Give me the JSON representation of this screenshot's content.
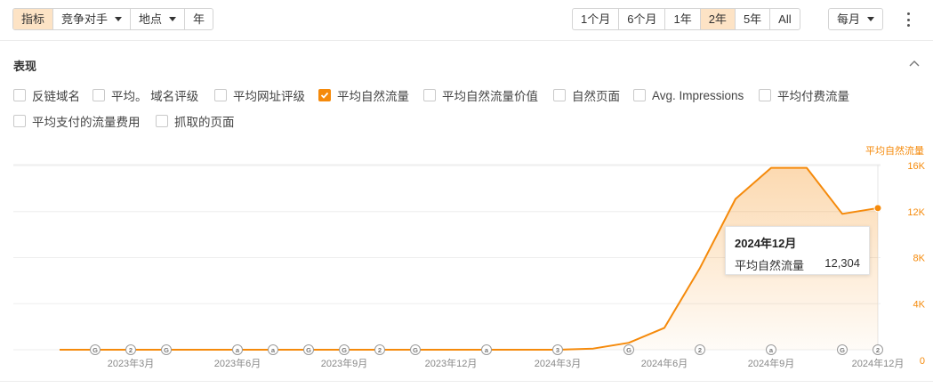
{
  "toolbar": {
    "left_buttons": [
      {
        "label": "指标",
        "active": true,
        "dropdown": false
      },
      {
        "label": "竞争对手",
        "active": false,
        "dropdown": true
      },
      {
        "label": "地点",
        "active": false,
        "dropdown": true
      },
      {
        "label": "年",
        "active": false,
        "dropdown": false
      }
    ],
    "ranges": [
      {
        "label": "1个月",
        "active": false
      },
      {
        "label": "6个月",
        "active": false
      },
      {
        "label": "1年",
        "active": false
      },
      {
        "label": "2年",
        "active": true
      },
      {
        "label": "5年",
        "active": false
      },
      {
        "label": "All",
        "active": false
      }
    ],
    "interval": {
      "label": "每月"
    },
    "menu_icon": "more-vertical-icon"
  },
  "section": {
    "title": "表现",
    "collapse_icon": "chevron-up-icon"
  },
  "metrics": [
    {
      "label": "反链域名",
      "checked": false
    },
    {
      "label": "平均。 域名评级",
      "checked": false
    },
    {
      "label": "平均网址评级",
      "checked": false
    },
    {
      "label": "平均自然流量",
      "checked": true
    },
    {
      "label": "平均自然流量价值",
      "checked": false
    },
    {
      "label": "自然页面",
      "checked": false
    },
    {
      "label": "Avg. Impressions",
      "checked": false
    },
    {
      "label": "平均付费流量",
      "checked": false
    },
    {
      "label": "平均支付的流量费用",
      "checked": false
    },
    {
      "label": "抓取的页面",
      "checked": false
    }
  ],
  "colors": {
    "accent": "#f58a0b",
    "accent_light": "#fde3c5",
    "grid": "#eeeeee",
    "axis_text": "#888888",
    "marker": "#9a9a9a"
  },
  "chart_data": {
    "type": "area",
    "ylabel": "平均自然流量",
    "ylim": [
      0,
      17000
    ],
    "yticks": [
      {
        "value": 16000,
        "label": "16K"
      },
      {
        "value": 12000,
        "label": "12K"
      },
      {
        "value": 8000,
        "label": "8K"
      },
      {
        "value": 4000,
        "label": "4K"
      },
      {
        "value": 0,
        "label": "0"
      }
    ],
    "xtick_labels": [
      "2023年3月",
      "2023年6月",
      "2023年9月",
      "2023年12月",
      "2024年3月",
      "2024年6月",
      "2024年9月",
      "2024年12月"
    ],
    "series": [
      {
        "name": "平均自然流量",
        "x": [
          "2023-01",
          "2023-02",
          "2023-03",
          "2023-04",
          "2023-05",
          "2023-06",
          "2023-07",
          "2023-08",
          "2023-09",
          "2023-10",
          "2023-11",
          "2023-12",
          "2024-01",
          "2024-02",
          "2024-03",
          "2024-04",
          "2024-05",
          "2024-06",
          "2024-07",
          "2024-08",
          "2024-09",
          "2024-10",
          "2024-11",
          "2024-12"
        ],
        "values": [
          0,
          0,
          0,
          0,
          0,
          0,
          0,
          0,
          0,
          0,
          0,
          0,
          0,
          0,
          0,
          100,
          600,
          1900,
          7100,
          13100,
          15800,
          15800,
          11800,
          12304
        ]
      }
    ],
    "grid": true,
    "legend": "none",
    "markers": [
      {
        "month": "2023-02",
        "label": "G"
      },
      {
        "month": "2023-03",
        "label": "2"
      },
      {
        "month": "2023-04",
        "label": "G"
      },
      {
        "month": "2023-06",
        "label": "a"
      },
      {
        "month": "2023-07",
        "label": "a"
      },
      {
        "month": "2023-08",
        "label": "G"
      },
      {
        "month": "2023-09",
        "label": "G"
      },
      {
        "month": "2023-10",
        "label": "2"
      },
      {
        "month": "2023-11",
        "label": "G"
      },
      {
        "month": "2024-01",
        "label": "a"
      },
      {
        "month": "2024-03",
        "label": "3"
      },
      {
        "month": "2024-05",
        "label": "G"
      },
      {
        "month": "2024-07",
        "label": "2"
      },
      {
        "month": "2024-09",
        "label": "a"
      },
      {
        "month": "2024-11",
        "label": "G"
      },
      {
        "month": "2024-12",
        "label": "2"
      }
    ],
    "tooltip": {
      "title": "2024年12月",
      "metric": "平均自然流量",
      "value": "12,304"
    }
  }
}
